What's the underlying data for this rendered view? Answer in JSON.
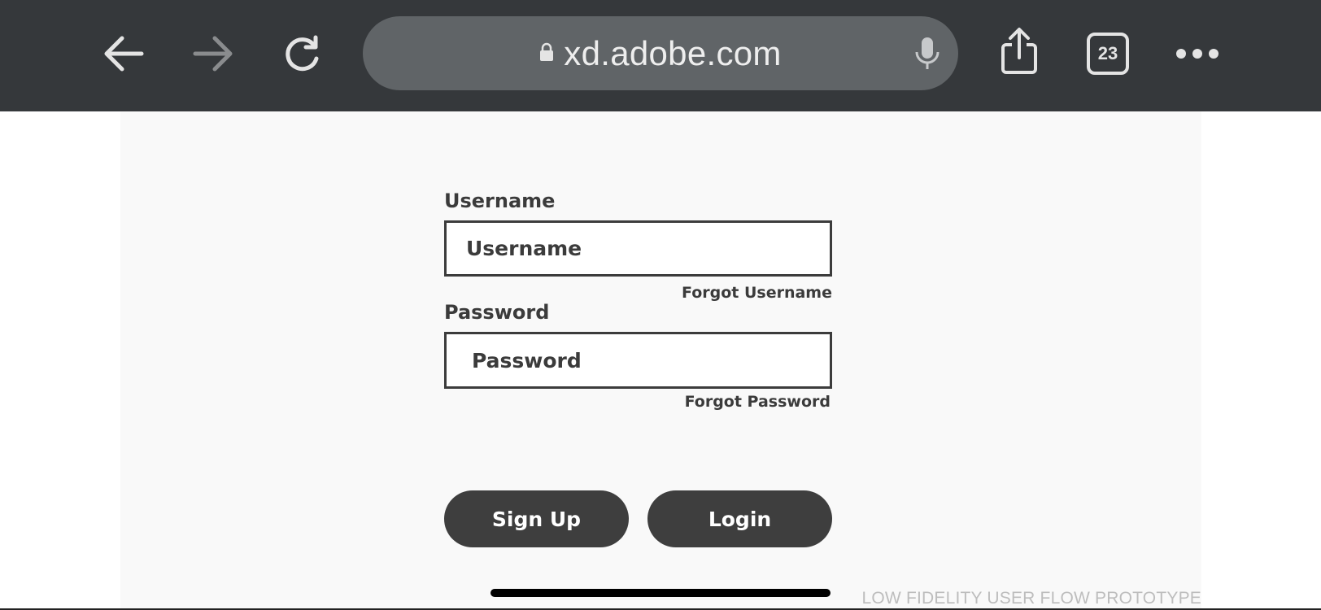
{
  "browser": {
    "url": "xd.adobe.com",
    "tab_count": "23",
    "icons": {
      "back": "arrow-left-icon",
      "forward": "arrow-right-icon",
      "reload": "reload-icon",
      "lock": "lock-icon",
      "mic": "microphone-icon",
      "share": "share-icon",
      "tabs": "tabs-icon",
      "more": "more-icon"
    },
    "colors": {
      "toolbar_bg": "#35383b",
      "urlbar_bg": "#606467",
      "icon_active": "#e4e4e4",
      "icon_disabled": "#8a8c8e"
    }
  },
  "login_form": {
    "username": {
      "label": "Username",
      "placeholder": "Username",
      "forgot_link": "Forgot Username"
    },
    "password": {
      "label": "Password",
      "placeholder": "Password",
      "forgot_link": "Forgot Password"
    },
    "buttons": {
      "signup": "Sign Up",
      "login": "Login"
    },
    "colors": {
      "button_bg": "#3e3e3e",
      "text": "#3b3b3b",
      "canvas_bg": "#f9f9f9"
    }
  },
  "footer": {
    "watermark": "LOW FIDELITY USER FLOW PROTOTYPE"
  }
}
